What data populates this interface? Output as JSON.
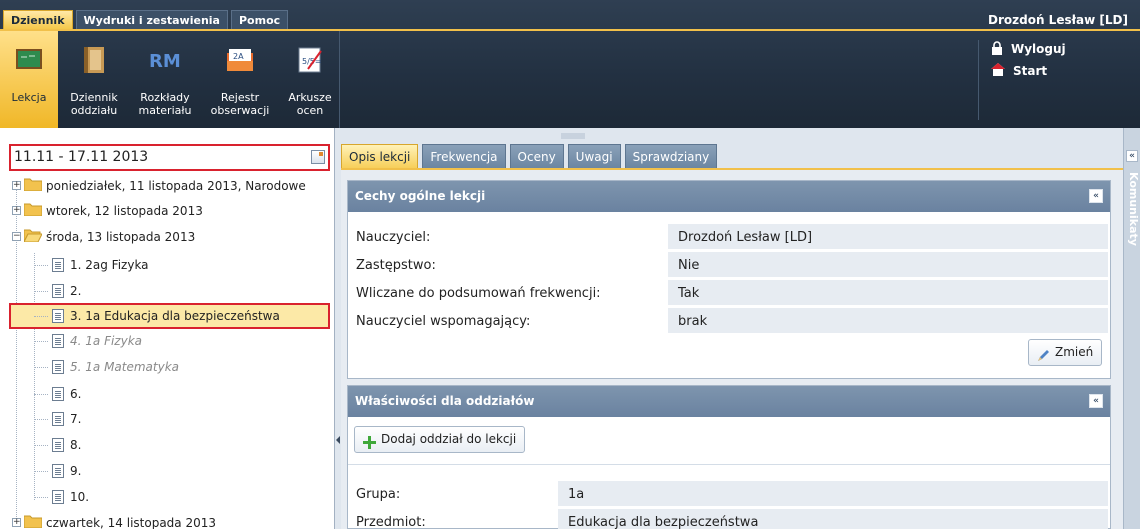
{
  "menu": {
    "tabs": [
      "Dziennik",
      "Wydruki i zestawienia",
      "Pomoc"
    ],
    "user": "Drozdoń Lesław [LD]"
  },
  "toolbar": {
    "items": [
      {
        "label": "Lekcja",
        "icon": "chalkboard-icon"
      },
      {
        "label": "Dziennik oddziału",
        "icon": "book-icon"
      },
      {
        "label": "Rozkłady materiału",
        "icon": "rm-icon"
      },
      {
        "label": "Rejestr obserwacji",
        "icon": "folder-register-icon"
      },
      {
        "label": "Arkusze ocen",
        "icon": "grades-sheet-icon"
      }
    ],
    "icon_rm_text": "RM",
    "icon_register_text": "2A",
    "icon_grades_text": "5/5="
  },
  "links": {
    "logout": "Wyloguj",
    "start": "Start"
  },
  "left": {
    "date_range": "11.11 - 17.11 2013",
    "days": [
      {
        "label": "poniedziałek, 11 listopada 2013, Narodowe",
        "expanded": false
      },
      {
        "label": "wtorek, 12 listopada 2013",
        "expanded": false
      },
      {
        "label": "środa, 13 listopada 2013",
        "expanded": true
      },
      {
        "label": "czwartek, 14 listopada 2013",
        "expanded": false
      }
    ],
    "lessons": [
      "1. 2ag Fizyka",
      "2.",
      "3. 1a Edukacja dla bezpieczeństwa",
      "4. 1a Fizyka",
      "5. 1a Matematyka",
      "6.",
      "7.",
      "8.",
      "9.",
      "10."
    ],
    "toggle_plus": "+",
    "toggle_minus": "−"
  },
  "tabs": [
    "Opis lekcji",
    "Frekwencja",
    "Oceny",
    "Uwagi",
    "Sprawdziany"
  ],
  "general": {
    "title": "Cechy ogólne lekcji",
    "toggle": "«",
    "rows": [
      {
        "label": "Nauczyciel:",
        "value": "Drozdoń Lesław [LD]"
      },
      {
        "label": "Zastępstwo:",
        "value": "Nie"
      },
      {
        "label": "Wliczane do podsumowań frekwencji:",
        "value": "Tak"
      },
      {
        "label": "Nauczyciel wspomagający:",
        "value": "brak"
      }
    ],
    "change_button": "Zmień"
  },
  "divisions": {
    "title": "Właściwości dla oddziałów",
    "toggle": "«",
    "add_button": "Dodaj oddział do lekcji",
    "rows": [
      {
        "label": "Grupa:",
        "value": "1a"
      },
      {
        "label": "Przedmiot:",
        "value": "Edukacja dla bezpieczeństwa"
      }
    ]
  },
  "right_strip": {
    "toggle": "«",
    "label": "Komunikaty"
  },
  "colors": {
    "accent": "#f1c04a",
    "header_bg": "#223041",
    "selection": "#fce9a7",
    "highlight_border": "#d9222e"
  }
}
